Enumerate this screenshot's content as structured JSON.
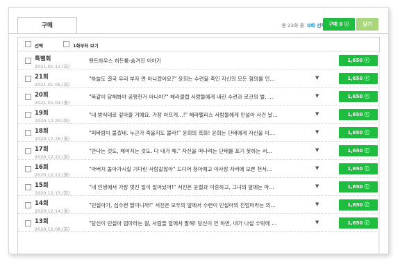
{
  "tab": {
    "label": "구매"
  },
  "summary": {
    "total": "총 23화 중",
    "selected": "0화 선택"
  },
  "buttons": {
    "buy_label": "구매 0 ⓒ",
    "cart_label": "담기"
  },
  "options": {
    "select_label": "선택",
    "from_first_label": "1화부터 보기"
  },
  "episodes": [
    {
      "num": "특별회",
      "date": "2021.01.12.(화)",
      "title": "펜트하우스 히든룸-숨겨진 이야기",
      "has_caret": false,
      "price": "1,650 ⓒ"
    },
    {
      "num": "21회",
      "date": "2021.01.05.(화)",
      "title": "\"하늘도 결국 우리 부자 편 아니겠어요?\" 윤희는 수련을 죽인 자신의 모든 혐의를 인…",
      "has_caret": true,
      "price": "1,650 ⓒ"
    },
    {
      "num": "20회",
      "date": "2021.01.04.(월)",
      "title": "\"뚝같이 당해봐야 공평한거 아니야?\" 헤라클럽 사람들에게 내린 수련과 로건의 벌, …",
      "has_caret": true,
      "price": "1,650 ⓒ"
    },
    {
      "num": "19회",
      "date": "2020.12.29.(화)",
      "title": "\"내 방식대로 갚아줄 거예요. 가장 아프게…!\" 헤라팰리스 사람들에게 민설아 사건 날…",
      "has_caret": true,
      "price": "1,650 ⓒ"
    },
    {
      "num": "18회",
      "date": "2020.12.28.(월)",
      "title": "\"피바람이 불겠네. 누군가 죽을지도 몰라!\" 윤희의 흑화! 윤희는 단태에게 자신을 이…",
      "has_caret": true,
      "price": "1,650 ⓒ"
    },
    {
      "num": "17회",
      "date": "2020.12.22.(화)",
      "title": "\"만나는 것도, 헤어지는 것도. 다 내가 해.\" 자신을 떠나려는 단태를 포기 못하는 서…",
      "has_caret": true,
      "price": "1,650 ⓒ"
    },
    {
      "num": "16회",
      "date": "2020.12.21.(월)",
      "title": "\"아버지 돌아가시길 기다린 사람같잖아\" 드디어 청아예고 이사장 자리에 오른 천서…",
      "has_caret": true,
      "price": "1,650 ⓒ"
    },
    {
      "num": "15회",
      "date": "2020.12.15.(화)",
      "title": "\"내 인생에서 가장 멋진 일이 일어났어!\" 서진은 윤철과 이혼하고, 그녀의 앞에는 마…",
      "has_caret": true,
      "price": "1,650 ⓒ"
    },
    {
      "num": "14회",
      "date": "2020.12.14.(월)",
      "title": "\"민설아가, 심수련 딸이니까!\" 서진은 모두의 앞에서 수련이 민설아의 친엄마라는 의…",
      "has_caret": true,
      "price": "1,650 ⓒ"
    },
    {
      "num": "13회",
      "date": "2020.12.08.(화)",
      "title": "\"당신이 민설아 엄마라는 걸, 사람들 앞에서 말해! 당신이 안 하면, 내가 나설 수밖에 …",
      "has_caret": true,
      "price": "1,650 ⓒ"
    }
  ]
}
